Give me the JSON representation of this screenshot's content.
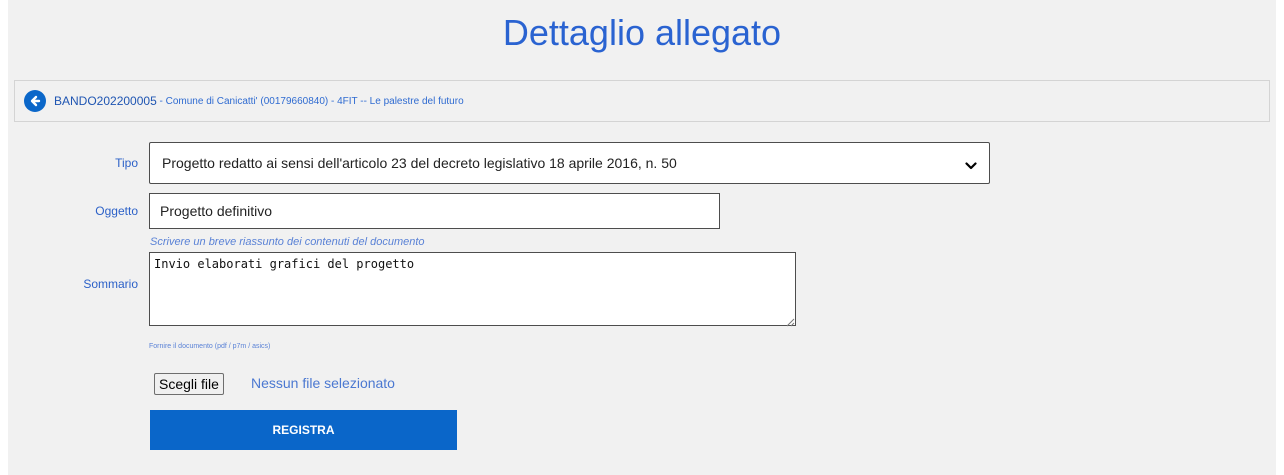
{
  "page": {
    "title": "Dettaglio allegato"
  },
  "breadcrumb": {
    "code": "BANDO202200005",
    "rest": " - Comune di Canicatti' (00179660840) - 4FIT -- Le palestre del futuro"
  },
  "form": {
    "tipo_label": "Tipo",
    "tipo_value": "Progetto redatto ai sensi dell'articolo 23 del decreto legislativo 18 aprile 2016, n. 50",
    "oggetto_label": "Oggetto",
    "oggetto_value": "Progetto definitivo",
    "sommario_hint": "Scrivere un breve riassunto dei contenuti del documento",
    "sommario_label": "Sommario",
    "sommario_value": "Invio elaborati grafici del progetto",
    "file_hint": "Fornire il documento (pdf / p7m / asics)",
    "file_button": "Scegli file",
    "file_status": "Nessun file selezionato",
    "submit_label": "REGISTRA"
  },
  "icons": {
    "back": "arrow-left-circle-icon",
    "select_arrow": "chevron-down-icon",
    "resize": "resize-grip-icon"
  },
  "colors": {
    "accent": "#0a66c9",
    "title": "#2a63d1",
    "panel_bg": "#f1f1f1"
  }
}
